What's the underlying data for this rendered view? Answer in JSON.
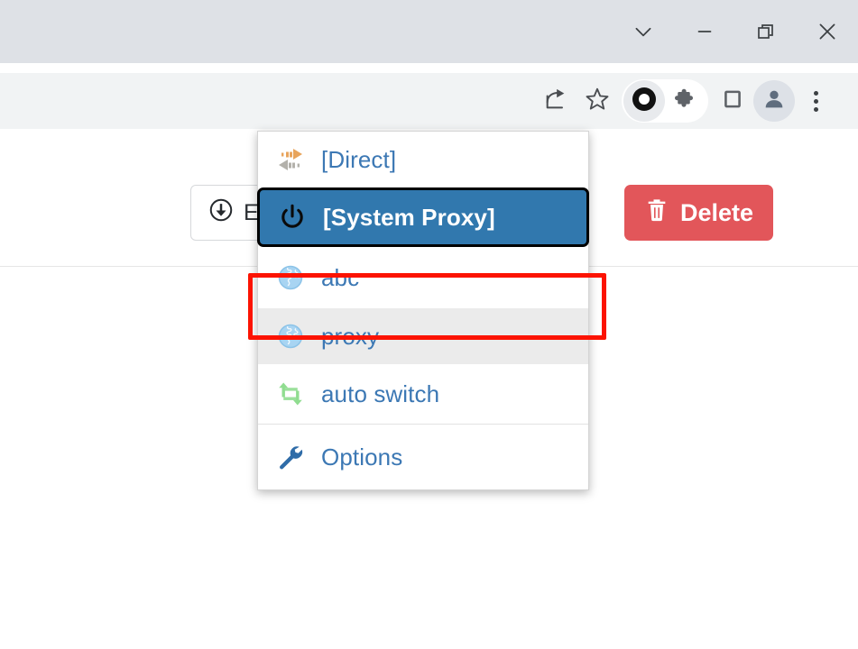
{
  "window": {
    "controls": [
      {
        "name": "chevron-down",
        "icon": "chevron-down-icon",
        "label": ""
      },
      {
        "name": "minimize",
        "icon": "minimize-icon",
        "label": ""
      },
      {
        "name": "restore",
        "icon": "restore-icon",
        "label": ""
      },
      {
        "name": "close",
        "icon": "close-icon",
        "label": ""
      }
    ]
  },
  "toolbar": {
    "icons": [
      {
        "name": "share-icon",
        "title": "Share this page"
      },
      {
        "name": "bookmark-star-icon",
        "title": "Bookmark this tab"
      },
      {
        "name": "proxy-switchyomega-extension-icon",
        "title": "SwitchyOmega"
      },
      {
        "name": "extensions-puzzle-icon",
        "title": "Extensions"
      },
      {
        "name": "side-panel-icon",
        "title": "Side panel"
      },
      {
        "name": "profile-avatar-icon",
        "title": "Profile"
      },
      {
        "name": "chrome-menu-icon",
        "title": "Customize and control"
      }
    ]
  },
  "page": {
    "import_button_label": "E",
    "delete_button_label": "Delete"
  },
  "popup": {
    "items": [
      {
        "icon": "direct-arrows-icon",
        "label": "[Direct]",
        "state": "normal"
      },
      {
        "icon": "power-icon",
        "label": "[System Proxy]",
        "state": "selected"
      },
      {
        "icon": "globe-icon",
        "label": "abc",
        "state": "highlighted"
      },
      {
        "icon": "globe-icon",
        "label": "proxy",
        "state": "hover"
      },
      {
        "icon": "auto-switch-icon",
        "label": "auto switch",
        "state": "normal"
      },
      {
        "icon": "wrench-icon",
        "label": "Options",
        "state": "normal"
      }
    ]
  },
  "annotation": {
    "highlight_color": "#fc1302",
    "highlight_target": "abc"
  },
  "colors": {
    "titlebar_bg": "#dee1e6",
    "toolbar_bg": "#f1f3f4",
    "selected_item_bg": "#3178ae",
    "hover_item_bg": "#ebebeb",
    "menu_label_color": "#3c78b4",
    "delete_button_bg": "#e2565a",
    "annotation_red": "#fc1302"
  }
}
